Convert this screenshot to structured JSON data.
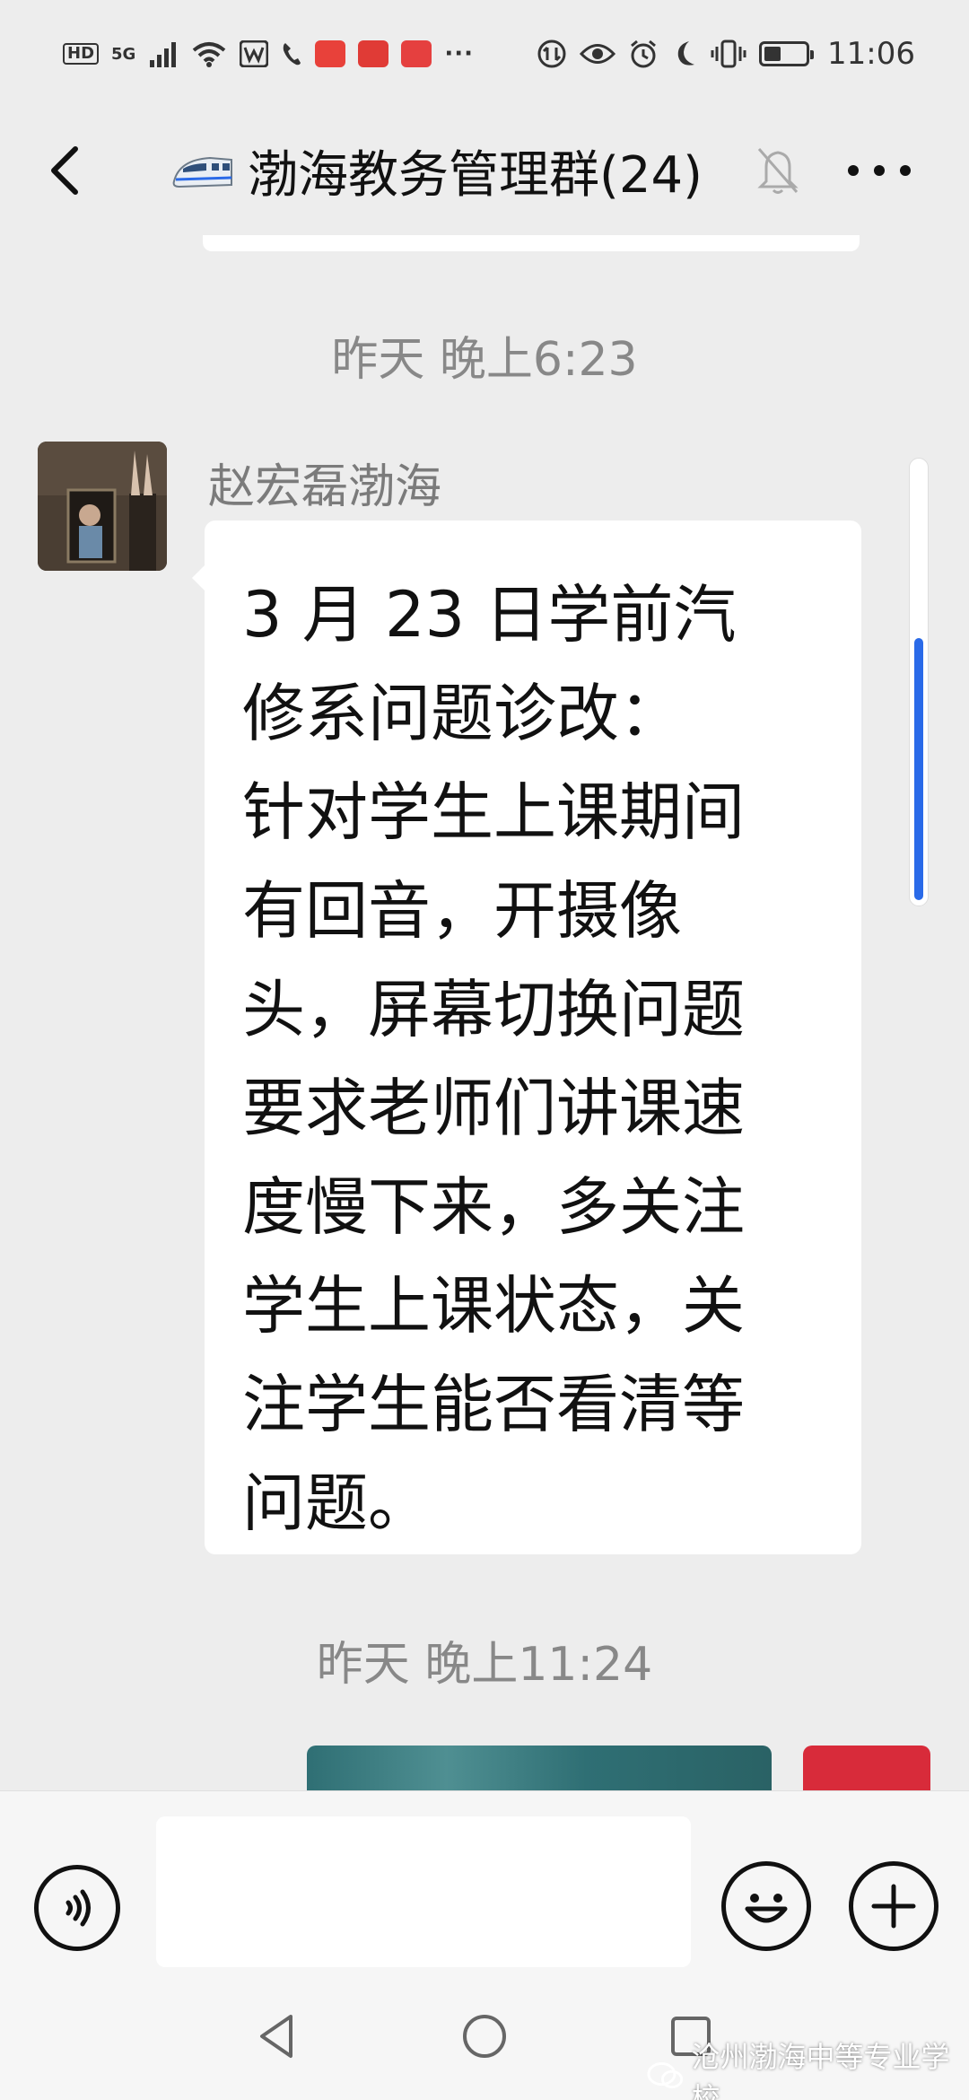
{
  "status_bar": {
    "hd": "HD",
    "network": "5G",
    "time": "11:06",
    "battery_percent": 40,
    "more": "···"
  },
  "header": {
    "title": "渤海教务管理群(24)",
    "back_icon": "chevron-left-icon",
    "muted_icon": "bell-off-icon",
    "more_icon": "more-dots-icon"
  },
  "messages": [
    {
      "timestamp": "昨天 晚上6:23",
      "sender": "赵宏磊渤海",
      "text": "3 月 23 日学前汽\n修系问题诊改：\n针对学生上课期间\n有回音，开摄像\n头，屏幕切换问题\n要求老师们讲课速\n度慢下来，多关注\n学生上课状态，关\n注学生能否看清等\n问题。"
    },
    {
      "timestamp": "昨天 晚上11:24"
    }
  ],
  "input_bar": {
    "input_value": "",
    "voice_icon": "voice-icon",
    "emoji_icon": "emoji-icon",
    "plus_icon": "plus-icon"
  },
  "watermark": {
    "text": "沧州渤海中等专业学校"
  },
  "colors": {
    "background": "#ededed",
    "bubble": "#ffffff",
    "scroll_thumb": "#2a6ae8",
    "timestamp": "#888888"
  }
}
